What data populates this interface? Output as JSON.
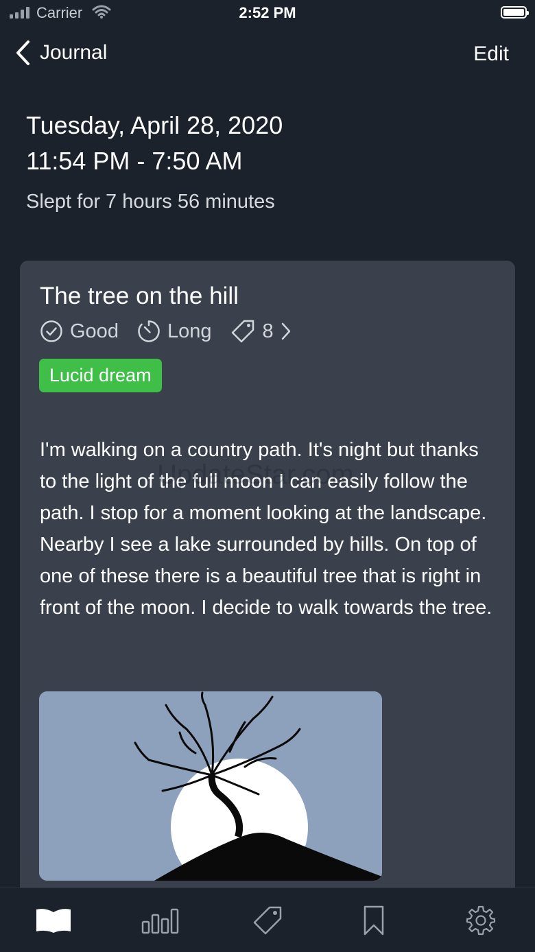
{
  "status_bar": {
    "carrier": "Carrier",
    "time": "2:52 PM"
  },
  "nav": {
    "back_label": "Journal",
    "edit_label": "Edit"
  },
  "entry": {
    "date": "Tuesday, April 28, 2020",
    "time_range": "11:54 PM - 7:50 AM",
    "slept": "Slept for 7 hours 56 minutes"
  },
  "dream": {
    "title": "The tree on the hill",
    "quality": "Good",
    "length": "Long",
    "tag_count": "8",
    "badge": "Lucid dream",
    "text": "I'm walking on a country path. It's night but thanks to the light of the full moon I can easily follow the path. I stop for a moment looking at the landscape. Nearby I see a lake surrounded by hills. On top of one of these there is a beautiful tree that is right in front of the moon. I decide to walk towards the tree.",
    "watermark": "UpdateStar.com"
  },
  "colors": {
    "background": "#1b222c",
    "card": "#3a414d",
    "badge": "#3fbf48",
    "image_sky": "#8da1bd"
  },
  "tabs": [
    {
      "icon": "book-icon",
      "active": true
    },
    {
      "icon": "stats-icon",
      "active": false
    },
    {
      "icon": "tag-icon",
      "active": false
    },
    {
      "icon": "bookmark-icon",
      "active": false
    },
    {
      "icon": "gear-icon",
      "active": false
    }
  ]
}
